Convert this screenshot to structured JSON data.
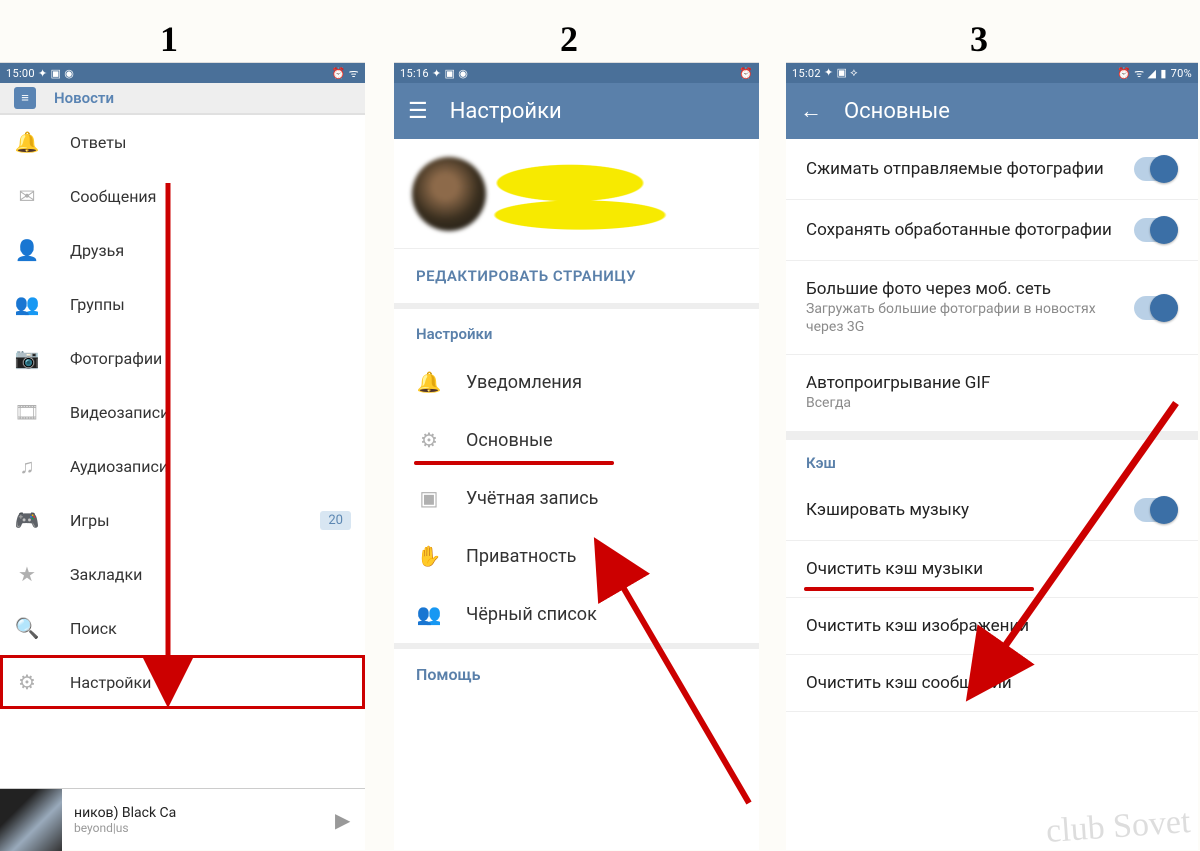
{
  "steps": {
    "one": "1",
    "two": "2",
    "three": "3"
  },
  "phone1": {
    "status": {
      "time": "15:00",
      "icons": "✦ ▣ ◉",
      "right": "⏰ ᯤ"
    },
    "head": {
      "label": "Новости"
    },
    "items": [
      {
        "icon": "🔔",
        "label": "Ответы"
      },
      {
        "icon": "✉",
        "label": "Сообщения"
      },
      {
        "icon": "👤",
        "label": "Друзья"
      },
      {
        "icon": "👥",
        "label": "Группы"
      },
      {
        "icon": "📷",
        "label": "Фотографии"
      },
      {
        "icon": "🎞",
        "label": "Видеозаписи"
      },
      {
        "icon": "♫",
        "label": "Аудиозаписи"
      },
      {
        "icon": "🎮",
        "label": "Игры",
        "badge": "20"
      },
      {
        "icon": "★",
        "label": "Закладки"
      },
      {
        "icon": "🔍",
        "label": "Поиск"
      },
      {
        "icon": "⚙",
        "label": "Настройки",
        "selected": true
      }
    ],
    "player": {
      "title": "ников)        Black Ca",
      "artist": "beyond|us"
    }
  },
  "phone2": {
    "status": {
      "time": "15:16",
      "icons": "✦ ▣ ◉",
      "right": "⏰"
    },
    "header": "Настройки",
    "edit": "РЕДАКТИРОВАТЬ СТРАНИЦУ",
    "section": "Настройки",
    "items": [
      {
        "icon": "🔔",
        "label": "Уведомления"
      },
      {
        "icon": "⚙",
        "label": "Основные",
        "under": true
      },
      {
        "icon": "▣",
        "label": "Учётная запись"
      },
      {
        "icon": "✋",
        "label": "Приватность"
      },
      {
        "icon": "👥",
        "label": "Чёрный список"
      }
    ],
    "help": "Помощь"
  },
  "phone3": {
    "status": {
      "time": "15:02",
      "icons": "✦ ▣ ⟡",
      "right": "⏰ ᯤ ◢",
      "batt": "70%"
    },
    "header": "Основные",
    "opts": [
      {
        "title": "Сжимать отправляемые фотографии",
        "toggle": true
      },
      {
        "title": "Сохранять обработанные фотографии",
        "toggle": true
      },
      {
        "title": "Большие фото через моб. сеть",
        "sub": "Загружать большие фотографии в новостях через 3G",
        "toggle": true
      },
      {
        "title": "Автопроигрывание GIF",
        "sub": "Всегда"
      }
    ],
    "cache_label": "Кэш",
    "cache": [
      {
        "title": "Кэшировать музыку",
        "toggle": true
      },
      {
        "title": "Очистить кэш музыки",
        "under": true
      },
      {
        "title": "Очистить кэш изображений"
      },
      {
        "title": "Очистить кэш сообщений"
      }
    ]
  },
  "watermark": "club\nSovet"
}
